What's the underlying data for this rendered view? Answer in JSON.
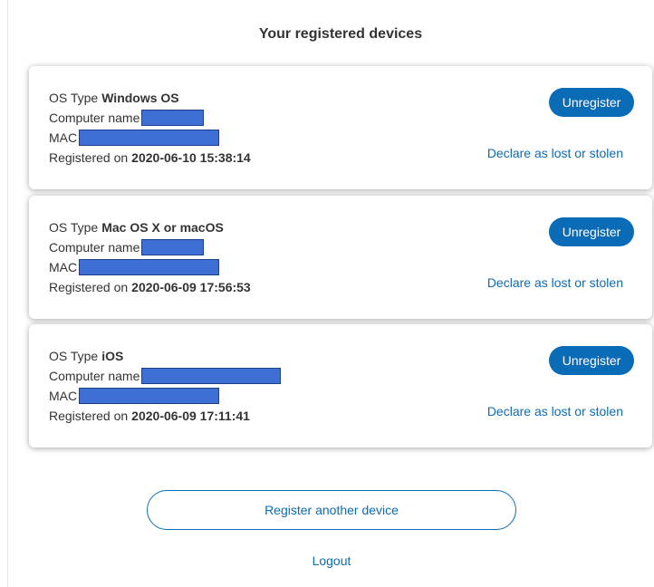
{
  "page_title": "Your registered devices",
  "labels": {
    "os_type": "OS Type",
    "computer_name": "Computer name",
    "mac": "MAC",
    "registered_on": "Registered on"
  },
  "devices": [
    {
      "os": "Windows OS",
      "registered_on": "2020-06-10 15:38:14",
      "unregister": "Unregister",
      "lost_link": "Declare as lost or stolen"
    },
    {
      "os": "Mac OS X or macOS",
      "registered_on": "2020-06-09 17:56:53",
      "unregister": "Unregister",
      "lost_link": "Declare as lost or stolen"
    },
    {
      "os": "iOS",
      "registered_on": "2020-06-09 17:11:41",
      "unregister": "Unregister",
      "lost_link": "Declare as lost or stolen"
    }
  ],
  "register_another": "Register another device",
  "logout": "Logout",
  "colors": {
    "accent": "#0a6cb7",
    "redaction": "#3d6fd4"
  }
}
